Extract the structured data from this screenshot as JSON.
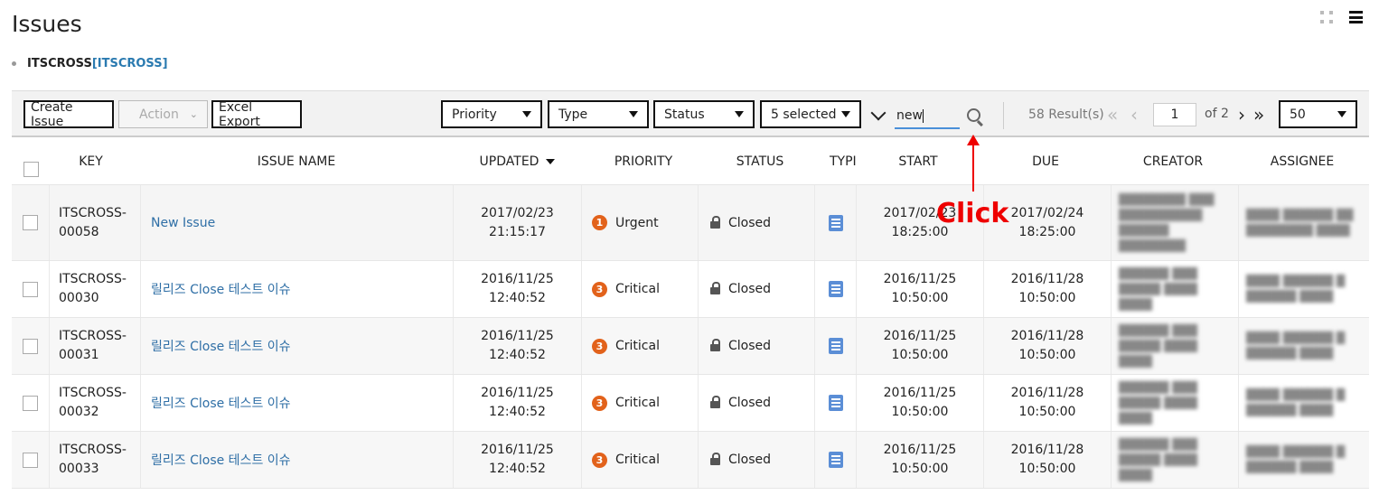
{
  "page": {
    "title": "Issues"
  },
  "project": {
    "name": "ITSCROSS",
    "code": "[ITSCROSS]"
  },
  "toolbar": {
    "create_label": "Create Issue",
    "action_label": "Action",
    "excel_label": "Excel Export",
    "priority_filter": "Priority",
    "type_filter": "Type",
    "status_filter": "Status",
    "selected_filter": "5 selected",
    "search_value": "new",
    "result_count": "58 Result(s)",
    "page_current": "1",
    "page_of": "of 2",
    "page_size": "50"
  },
  "table": {
    "headers": [
      "KEY",
      "ISSUE NAME",
      "UPDATED",
      "PRIORITY",
      "STATUS",
      "TYPI",
      "START",
      "DUE",
      "CREATOR",
      "ASSIGNEE"
    ],
    "rows": [
      {
        "key1": "ITSCROSS-",
        "key2": "00058",
        "name": "New Issue",
        "upd1": "2017/02/23",
        "upd2": "21:15:17",
        "pr_num": "1",
        "priority": "Urgent",
        "status": "Closed",
        "start1": "2017/02/23",
        "start2": "18:25:00",
        "due1": "2017/02/24",
        "due2": "18:25:00",
        "creator": "████████ ███ ██████████ ██████ ████████",
        "assignee": "████ ██████ ██ ████████ ████"
      },
      {
        "key1": "ITSCROSS-",
        "key2": "00030",
        "name": "릴리즈 Close 테스트 이슈",
        "upd1": "2016/11/25",
        "upd2": "12:40:52",
        "pr_num": "3",
        "priority": "Critical",
        "status": "Closed",
        "start1": "2016/11/25",
        "start2": "10:50:00",
        "due1": "2016/11/28",
        "due2": "10:50:00",
        "creator": "██████ ███ █████ ████ ████",
        "assignee": "████ ██████ █ ██████ ████"
      },
      {
        "key1": "ITSCROSS-",
        "key2": "00031",
        "name": "릴리즈 Close 테스트 이슈",
        "upd1": "2016/11/25",
        "upd2": "12:40:52",
        "pr_num": "3",
        "priority": "Critical",
        "status": "Closed",
        "start1": "2016/11/25",
        "start2": "10:50:00",
        "due1": "2016/11/28",
        "due2": "10:50:00",
        "creator": "██████ ███ █████ ████ ████",
        "assignee": "████ ██████ █ ██████ ████"
      },
      {
        "key1": "ITSCROSS-",
        "key2": "00032",
        "name": "릴리즈 Close 테스트 이슈",
        "upd1": "2016/11/25",
        "upd2": "12:40:52",
        "pr_num": "3",
        "priority": "Critical",
        "status": "Closed",
        "start1": "2016/11/25",
        "start2": "10:50:00",
        "due1": "2016/11/28",
        "due2": "10:50:00",
        "creator": "██████ ███ █████ ████ ████",
        "assignee": "████ ██████ █ ██████ ████"
      },
      {
        "key1": "ITSCROSS-",
        "key2": "00033",
        "name": "릴리즈 Close 테스트 이슈",
        "upd1": "2016/11/25",
        "upd2": "12:40:52",
        "pr_num": "3",
        "priority": "Critical",
        "status": "Closed",
        "start1": "2016/11/25",
        "start2": "10:50:00",
        "due1": "2016/11/28",
        "due2": "10:50:00",
        "creator": "██████ ███ █████ ████ ████",
        "assignee": "████ ██████ █ ██████ ████"
      }
    ]
  },
  "annotation": {
    "label": "Click",
    "color": "#e00000"
  },
  "colors": {
    "link": "#2f6fa6",
    "priority_badge": "#e2621b",
    "type_icon": "#5b8ed6",
    "search_underline": "#4a90d9"
  }
}
